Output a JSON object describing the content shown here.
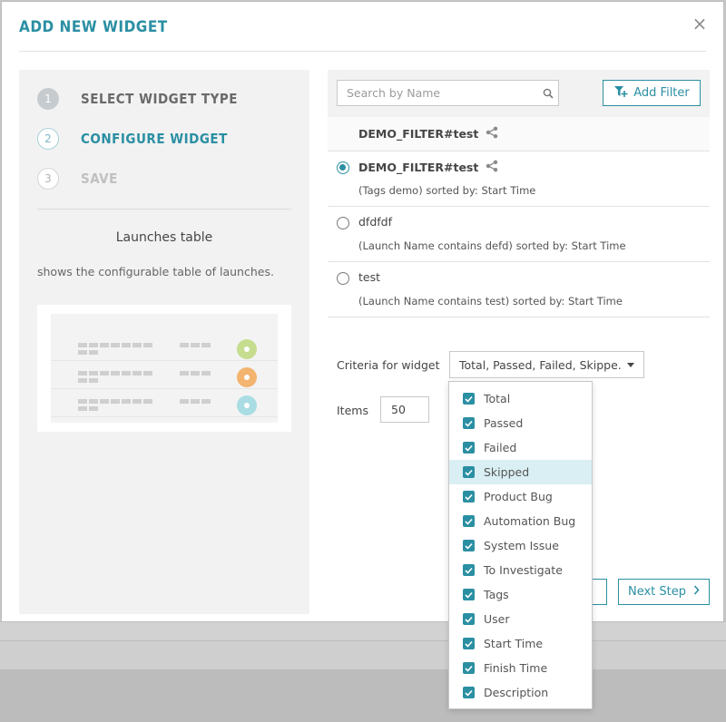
{
  "modal": {
    "title": "ADD NEW WIDGET",
    "close_symbol": "×"
  },
  "steps": [
    {
      "number": "1",
      "label": "SELECT WIDGET TYPE",
      "state": "completed"
    },
    {
      "number": "2",
      "label": "CONFIGURE WIDGET",
      "state": "active"
    },
    {
      "number": "3",
      "label": "SAVE",
      "state": "inactive"
    }
  ],
  "widget": {
    "name": "Launches table",
    "description": "shows the configurable table of launches."
  },
  "filters": {
    "search_placeholder": "Search by Name",
    "add_filter_label": "Add Filter",
    "active_filter_name": "DEMO_FILTER#test",
    "items": [
      {
        "name": "DEMO_FILTER#test",
        "description": "(Tags demo) sorted by: Start Time",
        "selected": true,
        "shared": true
      },
      {
        "name": "dfdfdf",
        "description": "(Launch Name contains defd) sorted by: Start Time",
        "selected": false,
        "shared": false
      },
      {
        "name": "test",
        "description": "(Launch Name contains test) sorted by: Start Time",
        "selected": false,
        "shared": false
      }
    ]
  },
  "criteria": {
    "label": "Criteria for widget",
    "selected_value": "Total, Passed, Failed, Skippe...",
    "options": [
      {
        "label": "Total",
        "checked": true
      },
      {
        "label": "Passed",
        "checked": true
      },
      {
        "label": "Failed",
        "checked": true
      },
      {
        "label": "Skipped",
        "checked": true
      },
      {
        "label": "Product Bug",
        "checked": true
      },
      {
        "label": "Automation Bug",
        "checked": true
      },
      {
        "label": "System Issue",
        "checked": true
      },
      {
        "label": "To Investigate",
        "checked": true
      },
      {
        "label": "Tags",
        "checked": true
      },
      {
        "label": "User",
        "checked": true
      },
      {
        "label": "Start Time",
        "checked": true
      },
      {
        "label": "Finish Time",
        "checked": true
      },
      {
        "label": "Description",
        "checked": true
      }
    ]
  },
  "items_field": {
    "label": "Items",
    "value": "50"
  },
  "buttons": {
    "next_step": "Next Step"
  },
  "colors": {
    "accent": "#2b8fa3",
    "panel_bg": "#f2f2f2",
    "hover": "#d9eff3"
  }
}
